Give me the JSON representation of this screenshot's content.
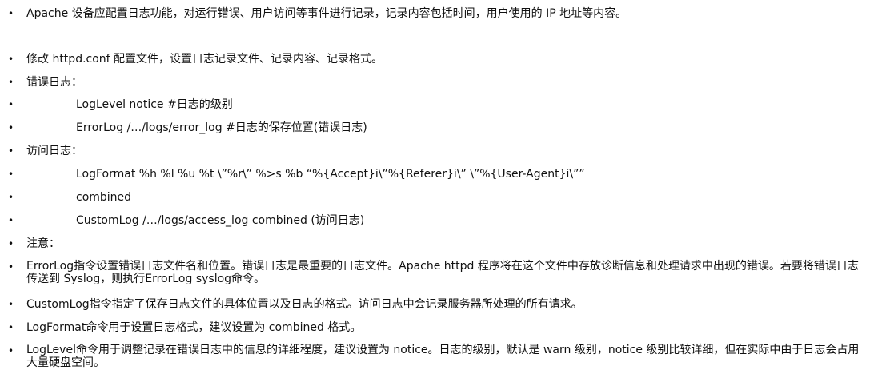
{
  "items": [
    {
      "text": "Apache 设备应配置日志功能，对运行错误、用户访问等事件进行记录，记录内容包括时间，用户使用的 IP 地址等内容。"
    },
    {
      "text": "修改 httpd.conf 配置文件，设置日志记录文件、记录内容、记录格式。"
    },
    {
      "text": "错误日志："
    },
    {
      "text": "LogLevel notice #日志的级别"
    },
    {
      "text": "ErrorLog /…/logs/error_log #日志的保存位置(错误日志)"
    },
    {
      "text": "访问日志："
    },
    {
      "text": "LogFormat %h %l %u %t \\”%r\\” %>s %b “%{Accept}i\\”%{Referer}i\\” \\”%{User-Agent}i\\””"
    },
    {
      "text": "combined"
    },
    {
      "text": "CustomLog /…/logs/access_log combined (访问日志)"
    },
    {
      "text": "注意："
    },
    {
      "text": "ErrorLog指令设置错误日志文件名和位置。错误日志是最重要的日志文件。Apache httpd 程序将在这个文件中存放诊断信息和处理请求中出现的错误。若要将错误日志传送到 Syslog，则执行ErrorLog syslog命令。"
    },
    {
      "text": "CustomLog指令指定了保存日志文件的具体位置以及日志的格式。访问日志中会记录服务器所处理的所有请求。"
    },
    {
      "text": "LogFormat命令用于设置日志格式，建议设置为 combined 格式。"
    },
    {
      "text": "LogLevel命令用于调整记录在错误日志中的信息的详细程度，建议设置为 notice。日志的级别，默认是 warn 级别，notice 级别比较详细，但在实际中由于日志会占用大量硬盘空间。"
    }
  ],
  "bullet_glyph": "•"
}
